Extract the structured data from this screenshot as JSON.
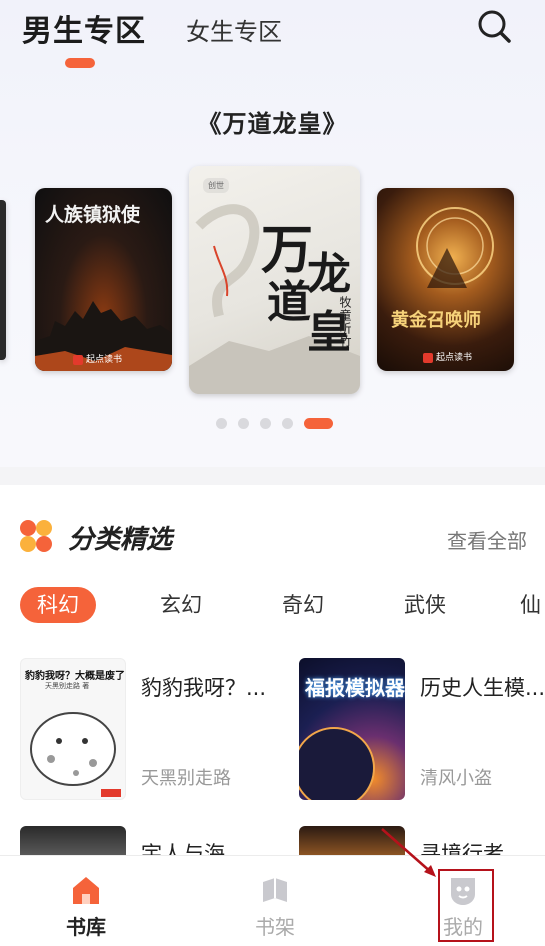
{
  "header": {
    "tab_male": "男生专区",
    "tab_female": "女生专区",
    "search_icon": "search-icon"
  },
  "featured": {
    "title": "《万道龙皇》",
    "books": [
      {
        "title": "人族镇狱使"
      },
      {
        "title": "万道龙皇",
        "author": "牧童听竹"
      },
      {
        "title": "黄金召唤师"
      }
    ],
    "publisher": "起点读书",
    "page_count": 5,
    "active_page": 5
  },
  "category": {
    "title": "分类精选",
    "see_all": "查看全部",
    "chips": [
      "科幻",
      "玄幻",
      "奇幻",
      "武侠",
      "仙"
    ],
    "active_chip": "科幻",
    "books": [
      {
        "name": "豹豹我呀？...",
        "author": "天黑别走路",
        "cover_title": "豹豹我呀？大概是废了",
        "cover_author": "天黑别走路 著"
      },
      {
        "name": "历史人生模...",
        "author": "清风小盗",
        "cover_title": "福报模拟器"
      },
      {
        "name": "宇人与海",
        "author": ""
      },
      {
        "name": "寻境行者",
        "author": ""
      }
    ]
  },
  "bottom_nav": {
    "items": [
      {
        "label": "书库",
        "icon": "home-icon",
        "active": true
      },
      {
        "label": "书架",
        "icon": "bookshelf-icon",
        "active": false
      },
      {
        "label": "我的",
        "icon": "profile-icon",
        "active": false
      }
    ]
  },
  "colors": {
    "accent": "#f5633a",
    "annotation": "#b5121b"
  }
}
